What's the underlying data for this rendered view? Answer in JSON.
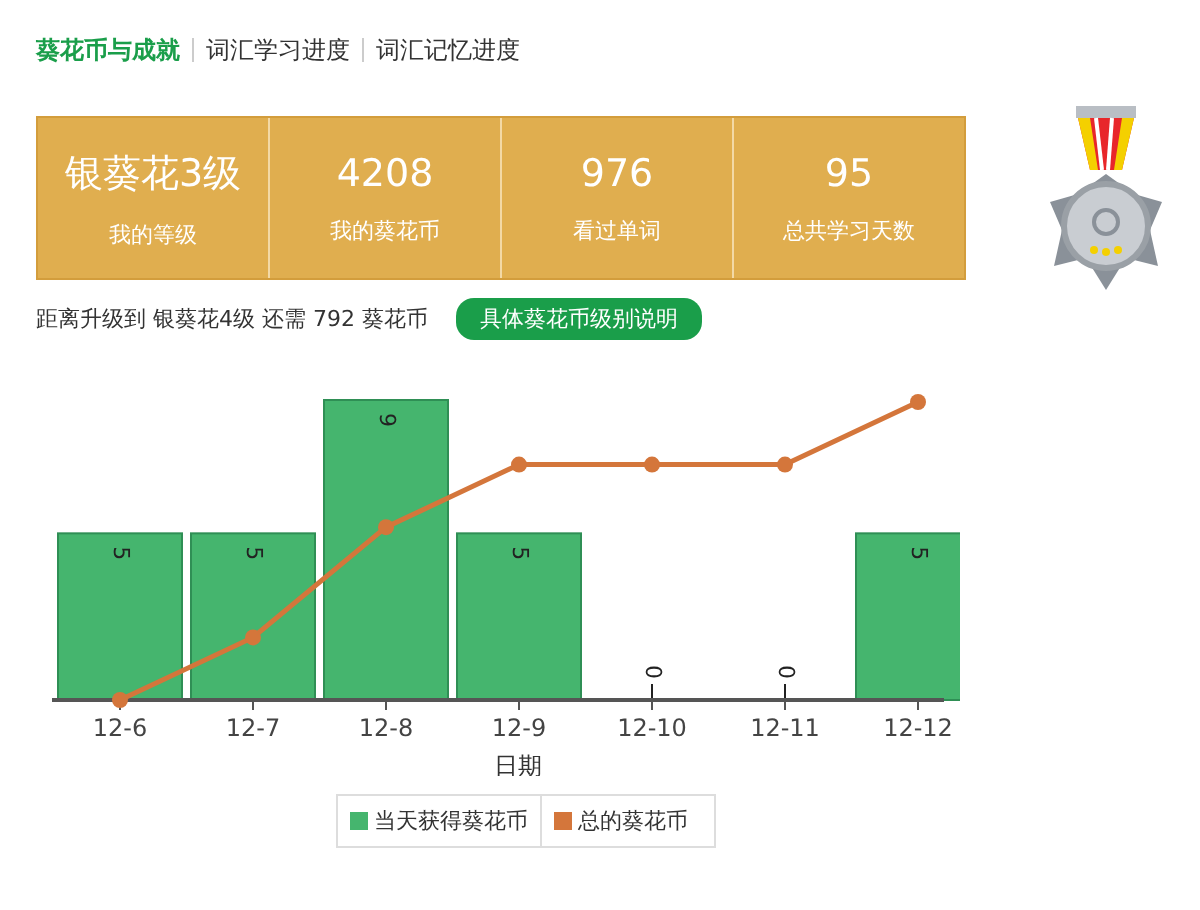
{
  "tabs": [
    {
      "label": "葵花币与成就",
      "selected": true
    },
    {
      "label": "词汇学习进度",
      "selected": false
    },
    {
      "label": "词汇记忆进度",
      "selected": false
    }
  ],
  "stats": [
    {
      "value": "银葵花3级",
      "label": "我的等级"
    },
    {
      "value": "4208",
      "label": "我的葵花币"
    },
    {
      "value": "976",
      "label": "看过单词"
    },
    {
      "value": "95",
      "label": "总共学习天数"
    }
  ],
  "progress": {
    "text": "距离升级到 银葵花4级 还需 792 葵花币",
    "button": "具体葵花币级别说明"
  },
  "chart_data": {
    "type": "bar",
    "xlabel": "日期",
    "categories": [
      "12-6",
      "12-7",
      "12-8",
      "12-9",
      "12-10",
      "12-11",
      "12-12"
    ],
    "data_labels": true,
    "series": [
      {
        "name": "当天获得葵花币",
        "color": "#45b56e",
        "values": [
          5,
          5,
          9,
          5,
          0,
          0,
          5
        ]
      }
    ]
  },
  "trend_line": {
    "name": "总的葵花币",
    "color": "#d4763b"
  }
}
